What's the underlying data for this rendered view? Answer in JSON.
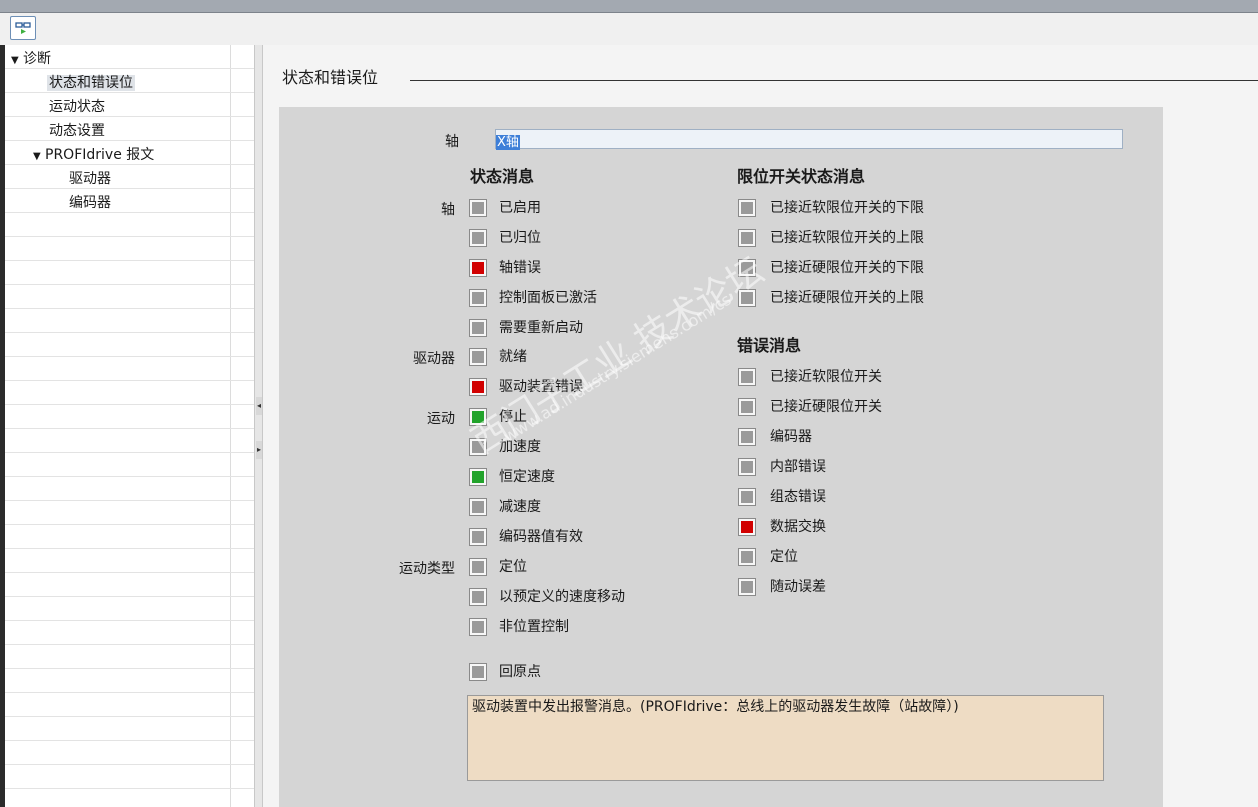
{
  "tree": {
    "items": [
      {
        "label": "诊断",
        "expanded": true
      },
      {
        "label": "状态和错误位",
        "selected": true
      },
      {
        "label": "运动状态"
      },
      {
        "label": "动态设置"
      },
      {
        "label": "PROFIdrive 报文",
        "expanded": true
      },
      {
        "label": "驱动器"
      },
      {
        "label": "编码器"
      }
    ]
  },
  "section": {
    "title": "状态和错误位"
  },
  "axis": {
    "label": "轴",
    "value": "X轴"
  },
  "status": {
    "header": "状态消息",
    "group_axis": "轴",
    "group_drive": "驱动器",
    "group_motion": "运动",
    "group_motion_type": "运动类型",
    "items": [
      {
        "label": "已启用",
        "state": "gray"
      },
      {
        "label": "已归位",
        "state": "gray"
      },
      {
        "label": "轴错误",
        "state": "red"
      },
      {
        "label": "控制面板已激活",
        "state": "gray"
      },
      {
        "label": "需要重新启动",
        "state": "gray"
      },
      {
        "label": "就绪",
        "state": "gray"
      },
      {
        "label": "驱动装置错误",
        "state": "red"
      },
      {
        "label": "停止",
        "state": "green"
      },
      {
        "label": "加速度",
        "state": "gray"
      },
      {
        "label": "恒定速度",
        "state": "green"
      },
      {
        "label": "减速度",
        "state": "gray"
      },
      {
        "label": "编码器值有效",
        "state": "gray"
      },
      {
        "label": "定位",
        "state": "gray"
      },
      {
        "label": "以预定义的速度移动",
        "state": "gray"
      },
      {
        "label": "非位置控制",
        "state": "gray"
      },
      {
        "label": "回原点",
        "state": "gray"
      }
    ]
  },
  "limits": {
    "header": "限位开关状态消息",
    "items": [
      {
        "label": "已接近软限位开关的下限",
        "state": "gray"
      },
      {
        "label": "已接近软限位开关的上限",
        "state": "gray"
      },
      {
        "label": "已接近硬限位开关的下限",
        "state": "gray"
      },
      {
        "label": "已接近硬限位开关的上限",
        "state": "gray"
      }
    ]
  },
  "errors": {
    "header": "错误消息",
    "items": [
      {
        "label": "已接近软限位开关",
        "state": "gray"
      },
      {
        "label": "已接近硬限位开关",
        "state": "gray"
      },
      {
        "label": "编码器",
        "state": "gray"
      },
      {
        "label": "内部错误",
        "state": "gray"
      },
      {
        "label": "组态错误",
        "state": "gray"
      },
      {
        "label": "数据交换",
        "state": "red"
      },
      {
        "label": "定位",
        "state": "gray"
      },
      {
        "label": "随动误差",
        "state": "gray"
      }
    ]
  },
  "message": {
    "text": "驱动装置中发出报警消息。(PROFIdrive：总线上的驱动器发生故障（站故障）)"
  },
  "watermark": {
    "main": "西门子工业 技术论坛",
    "url": "www.ad.industry.siemens.com/cs"
  },
  "colors": {
    "red": "#d10000",
    "green": "#22a32b",
    "gray": "#9a9a9a",
    "message_bg": "#eedcc4"
  }
}
